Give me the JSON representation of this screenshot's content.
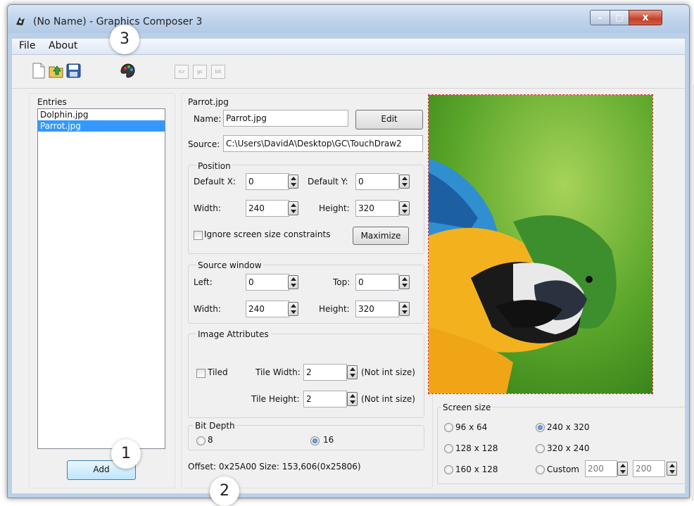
{
  "window": {
    "title": "(No Name) - Graphics Composer 3",
    "minimize": "–",
    "maximize": "□",
    "close": "x"
  },
  "menu": {
    "file": "File",
    "about": "About"
  },
  "toolbar": {
    "icons": [
      "new-file-icon",
      "open-folder-icon",
      "save-icon",
      "palette-icon"
    ],
    "disabled_buttons": [
      "rcr",
      "gc",
      "bit"
    ]
  },
  "entries": {
    "label": "Entries",
    "items": [
      "Dolphin.jpg",
      "Parrot.jpg"
    ],
    "selected_index": 1,
    "add_button": "Add"
  },
  "details": {
    "heading": "Parrot.jpg",
    "name_label": "Name:",
    "name_value": "Parrot.jpg",
    "edit_button": "Edit",
    "source_label": "Source:",
    "source_value": "C:\\Users\\DavidA\\Desktop\\GC\\TouchDraw2"
  },
  "position": {
    "title": "Position",
    "default_x_label": "Default X:",
    "default_x": "0",
    "default_y_label": "Default Y:",
    "default_y": "0",
    "width_label": "Width:",
    "width": "240",
    "height_label": "Height:",
    "height": "320",
    "ignore_label": "Ignore screen size constraints",
    "maximize_button": "Maximize"
  },
  "source_window": {
    "title": "Source window",
    "left_label": "Left:",
    "left": "0",
    "top_label": "Top:",
    "top": "0",
    "width_label": "Width:",
    "width": "240",
    "height_label": "Height:",
    "height": "320"
  },
  "image_attributes": {
    "title": "Image Attributes",
    "tiled_label": "Tiled",
    "tile_width_label": "Tile Width:",
    "tile_width": "2",
    "tile_width_note": "(Not int size)",
    "tile_height_label": "Tile Height:",
    "tile_height": "2",
    "tile_height_note": "(Not int size)"
  },
  "bit_depth": {
    "title": "Bit Depth",
    "opt_8": "8",
    "opt_16": "16",
    "selected": "16"
  },
  "status": {
    "offset": "Offset: 0x25A00  Size: 153,606(0x25806)"
  },
  "screen_size": {
    "title": "Screen size",
    "options": [
      "96 x 64",
      "240 x 320",
      "128 x 128",
      "320 x 240",
      "160 x 128",
      "Custom"
    ],
    "selected": "240 x 320",
    "custom_w": "200",
    "custom_h": "200"
  },
  "callouts": [
    "3",
    "1",
    "2"
  ],
  "colors": {
    "selection": "#3399ff",
    "title_gradient_top": "#d7e5f5",
    "close_red": "#c3402b",
    "preview_border": "#e03030"
  }
}
